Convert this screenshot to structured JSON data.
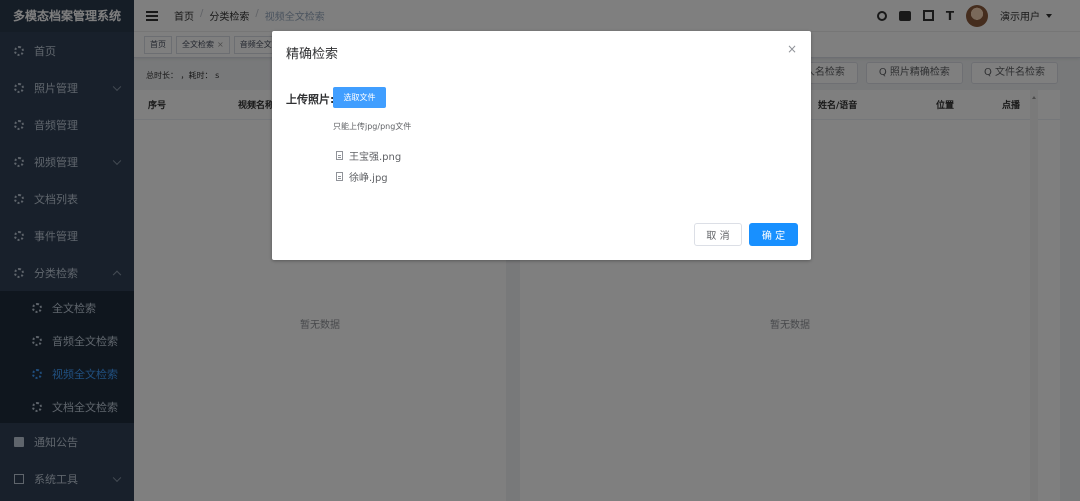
{
  "app": {
    "title": "多模态档案管理系统"
  },
  "sidebar": {
    "items": [
      {
        "label": "首页"
      },
      {
        "label": "照片管理"
      },
      {
        "label": "音频管理"
      },
      {
        "label": "视频管理"
      },
      {
        "label": "文档列表"
      },
      {
        "label": "事件管理"
      },
      {
        "label": "分类检索"
      }
    ],
    "sub_items": [
      {
        "label": "全文检索"
      },
      {
        "label": "音频全文检索"
      },
      {
        "label": "视频全文检索"
      },
      {
        "label": "文档全文检索"
      }
    ],
    "bottom_items": [
      {
        "label": "通知公告"
      },
      {
        "label": "系统工具"
      }
    ]
  },
  "header": {
    "breadcrumb": [
      "首页",
      "分类检索",
      "视频全文检索"
    ],
    "breadcrumb_sep": "/",
    "username": "演示用户",
    "font_size_icon_label": "T"
  },
  "tags": [
    {
      "label": "首页"
    },
    {
      "label": "全文检索",
      "close": "×"
    },
    {
      "label": "音频全文检"
    }
  ],
  "main": {
    "stats_text": "总时长： ，耗时： s",
    "buttons": {
      "name_search": "人名检索",
      "photo_precise": "Q 照片精确检索",
      "filename_search": "Q 文件名检索"
    },
    "left_table": {
      "columns": [
        "序号",
        "视频名称"
      ],
      "empty": "暂无数据"
    },
    "right_table": {
      "columns": [
        "姓名/语音",
        "位置",
        "点播"
      ],
      "empty": "暂无数据"
    }
  },
  "dialog": {
    "title": "精确检索",
    "close": "×",
    "upload_label": "上传照片:",
    "select_button": "选取文件",
    "tip": "只能上传jpg/png文件",
    "files": [
      "王宝强.png",
      "徐峥.jpg"
    ],
    "cancel": "取 消",
    "ok": "确 定"
  },
  "colors": {
    "primary": "#409eff",
    "sidebar_bg": "#304156",
    "ok_button": "#1890ff"
  }
}
